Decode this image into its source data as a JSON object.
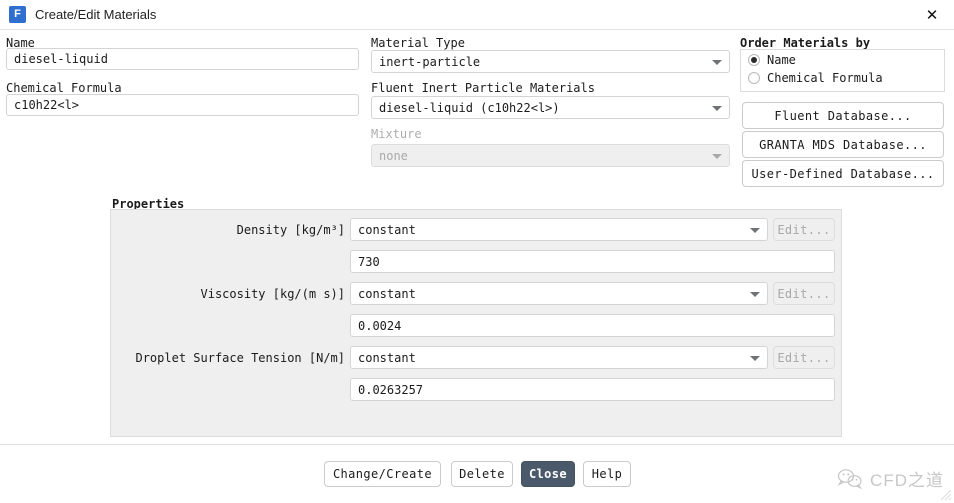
{
  "window": {
    "title": "Create/Edit Materials",
    "icon": "fluent-f-icon",
    "close_icon": "close-icon"
  },
  "left_column": {
    "name_label": "Name",
    "name_value": "diesel-liquid",
    "formula_label": "Chemical Formula",
    "formula_value": "c10h22<l>"
  },
  "middle_column": {
    "material_type_label": "Material Type",
    "material_type_value": "inert-particle",
    "inert_materials_label": "Fluent Inert Particle Materials",
    "inert_materials_value": "diesel-liquid (c10h22<l>)",
    "mixture_label": "Mixture",
    "mixture_value": "none"
  },
  "right_column": {
    "order_by_label": "Order Materials by",
    "options": [
      {
        "label": "Name",
        "selected": true
      },
      {
        "label": "Chemical Formula",
        "selected": false
      }
    ],
    "buttons": [
      "Fluent Database...",
      "GRANTA MDS Database...",
      "User-Defined Database..."
    ]
  },
  "properties": {
    "title": "Properties",
    "rows": [
      {
        "label": "Density [kg/m³]",
        "method": "constant",
        "edit_label": "Edit...",
        "value": "730"
      },
      {
        "label": "Viscosity [kg/(m s)]",
        "method": "constant",
        "edit_label": "Edit...",
        "value": "0.0024"
      },
      {
        "label": "Droplet Surface Tension [N/m]",
        "method": "constant",
        "edit_label": "Edit...",
        "value": "0.0263257"
      }
    ]
  },
  "footer": {
    "buttons": [
      {
        "label": "Change/Create",
        "primary": false
      },
      {
        "label": "Delete",
        "primary": false
      },
      {
        "label": "Close",
        "primary": true
      },
      {
        "label": "Help",
        "primary": false
      }
    ]
  },
  "watermark": {
    "text": "CFD之道",
    "icon": "wechat-logo-icon"
  },
  "colors": {
    "accent": "#2f6fd0",
    "primary_button": "#4b5a6b",
    "panel": "#efeff0",
    "border": "#d2d4d6"
  }
}
